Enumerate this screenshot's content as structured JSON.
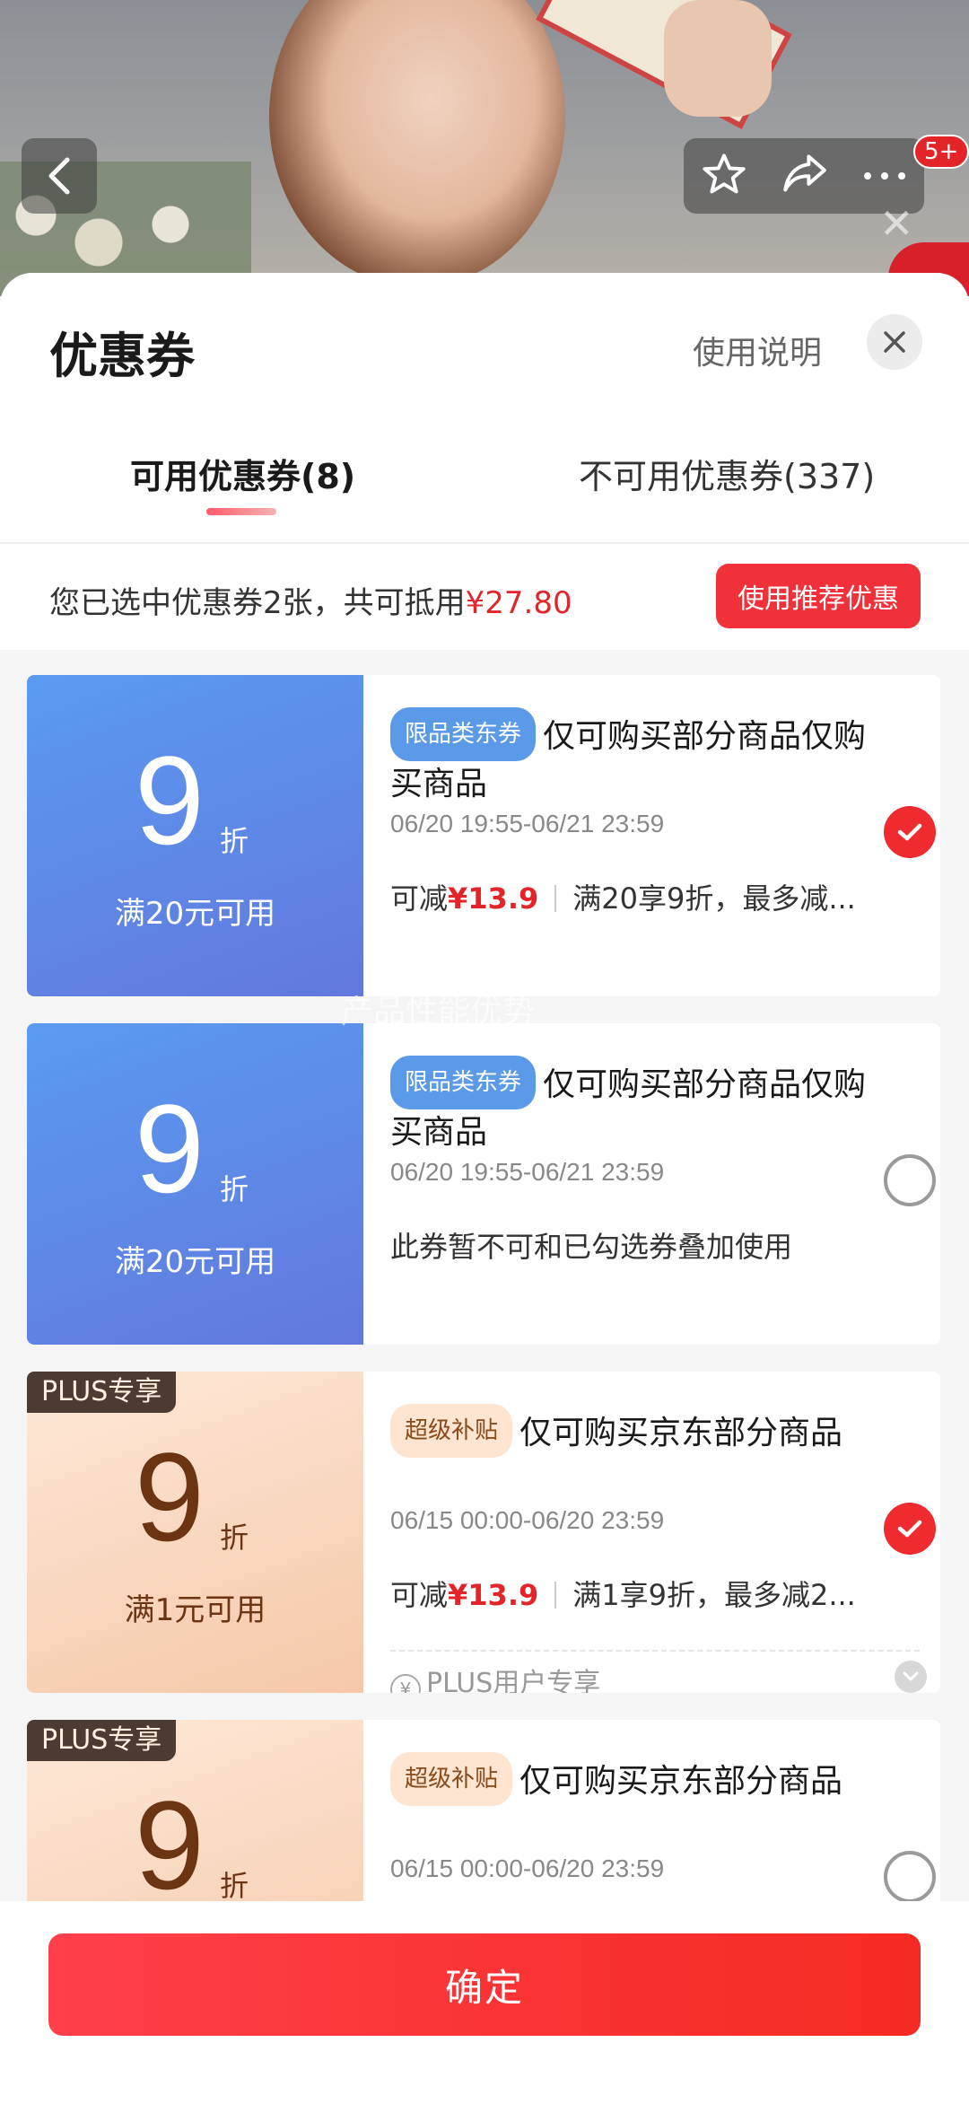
{
  "header": {
    "cart_badge": "5+"
  },
  "sheet": {
    "title": "优惠券",
    "help_link": "使用说明",
    "tabs": [
      {
        "label": "可用优惠券(8)",
        "active": true
      },
      {
        "label": "不可用优惠券(337)",
        "active": false
      }
    ],
    "summary_prefix": "您已选中优惠券2张，共可抵用",
    "summary_amount": "¥27.80",
    "recommend_button": "使用推荐优惠"
  },
  "coupons": [
    {
      "theme": "blue",
      "value": "9",
      "unit": "折",
      "condition": "满20元可用",
      "tag": "限品类东券",
      "title": "仅可购买部分商品仅购买商品",
      "date": "06/20 19:55-06/21 23:59",
      "desc_prefix": "可减",
      "desc_amount": "¥13.9",
      "desc_rule": "满20享9折，最多减...",
      "checked": true
    },
    {
      "theme": "blue",
      "value": "9",
      "unit": "折",
      "condition": "满20元可用",
      "tag": "限品类东券",
      "title": "仅可购买部分商品仅购买商品",
      "date": "06/20 19:55-06/21 23:59",
      "note": "此券暂不可和已勾选券叠加使用",
      "checked": false
    },
    {
      "theme": "peach",
      "plus_tag": "PLUS专享",
      "value": "9",
      "unit": "折",
      "condition": "满1元可用",
      "tag": "超级补贴",
      "title": "仅可购买京东部分商品",
      "date": "06/15 00:00-06/20 23:59",
      "desc_prefix": "可减",
      "desc_amount": "¥13.9",
      "desc_rule": "满1享9折，最多减2...",
      "footer": "PLUS用户专享",
      "checked": true
    },
    {
      "theme": "peach",
      "plus_tag": "PLUS专享",
      "value": "9",
      "unit": "折",
      "tag": "超级补贴",
      "title": "仅可购买京东部分商品",
      "date": "06/15 00:00-06/20 23:59",
      "checked": false
    }
  ],
  "watermark": "产品性能优势",
  "footer": {
    "confirm_button": "确定"
  },
  "colors": {
    "accent_red": "#f0313a",
    "coupon_blue": "#5a9bf0",
    "coupon_peach": "#fde8d8"
  }
}
